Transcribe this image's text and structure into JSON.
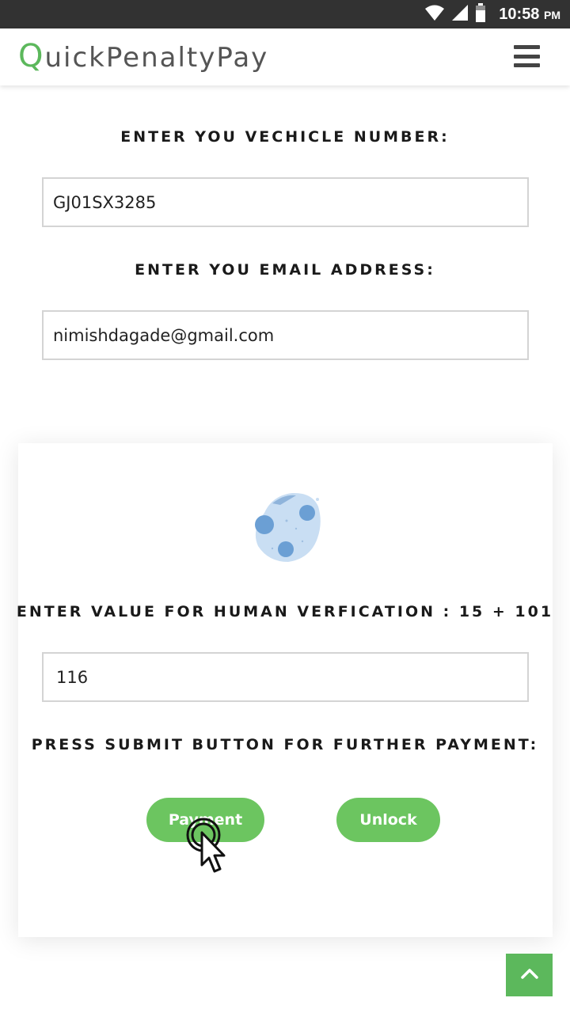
{
  "status_bar": {
    "time": "10:58",
    "ampm": "PM",
    "icons": [
      "wifi-icon",
      "signal-icon",
      "battery-icon"
    ]
  },
  "header": {
    "brand_first_letter": "Q",
    "brand_rest": "uickPenaltyPay",
    "menu_icon": "hamburger-menu-icon"
  },
  "vehicle": {
    "label": "ENTER YOU VECHICLE NUMBER:",
    "value": "GJ01SX3285"
  },
  "email": {
    "label": "ENTER YOU EMAIL ADDRESS:",
    "value": "nimishdagade@gmail.com"
  },
  "verification": {
    "label": "ENTER VALUE FOR HUMAN VERFICATION : 15 + 101",
    "value": "116",
    "illustration": "moon-planet-icon"
  },
  "submit": {
    "label": "PRESS SUBMIT BUTTON FOR FURTHER PAYMENT:",
    "payment_button": "Payment",
    "unlock_button": "Unlock"
  },
  "back_to_top_icon": "chevron-up-icon",
  "colors": {
    "accent_green": "#6cc560",
    "status_bar": "#323232",
    "brand_green": "#5cb85c"
  }
}
